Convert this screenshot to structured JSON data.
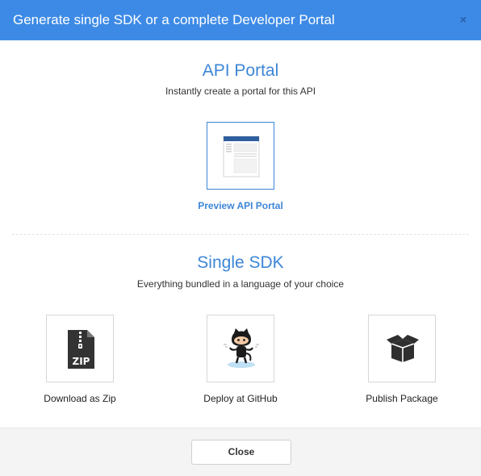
{
  "modal": {
    "title": "Generate single SDK or a complete Developer Portal",
    "close_glyph": "×"
  },
  "api_portal": {
    "title": "API Portal",
    "subtitle": "Instantly create a portal for this API",
    "tile_icon": "portal-page-icon",
    "link_label": "Preview API Portal"
  },
  "single_sdk": {
    "title": "Single SDK",
    "subtitle": "Everything bundled in a language of your choice",
    "options": [
      {
        "label": "Download as Zip",
        "icon": "zip-file-icon"
      },
      {
        "label": "Deploy at GitHub",
        "icon": "github-octocat-icon"
      },
      {
        "label": "Publish Package",
        "icon": "package-box-icon"
      }
    ]
  },
  "footer": {
    "close_label": "Close"
  },
  "colors": {
    "header_bg": "#3d8ae6",
    "accent": "#3d86d6",
    "footer_bg": "#f4f4f4"
  }
}
